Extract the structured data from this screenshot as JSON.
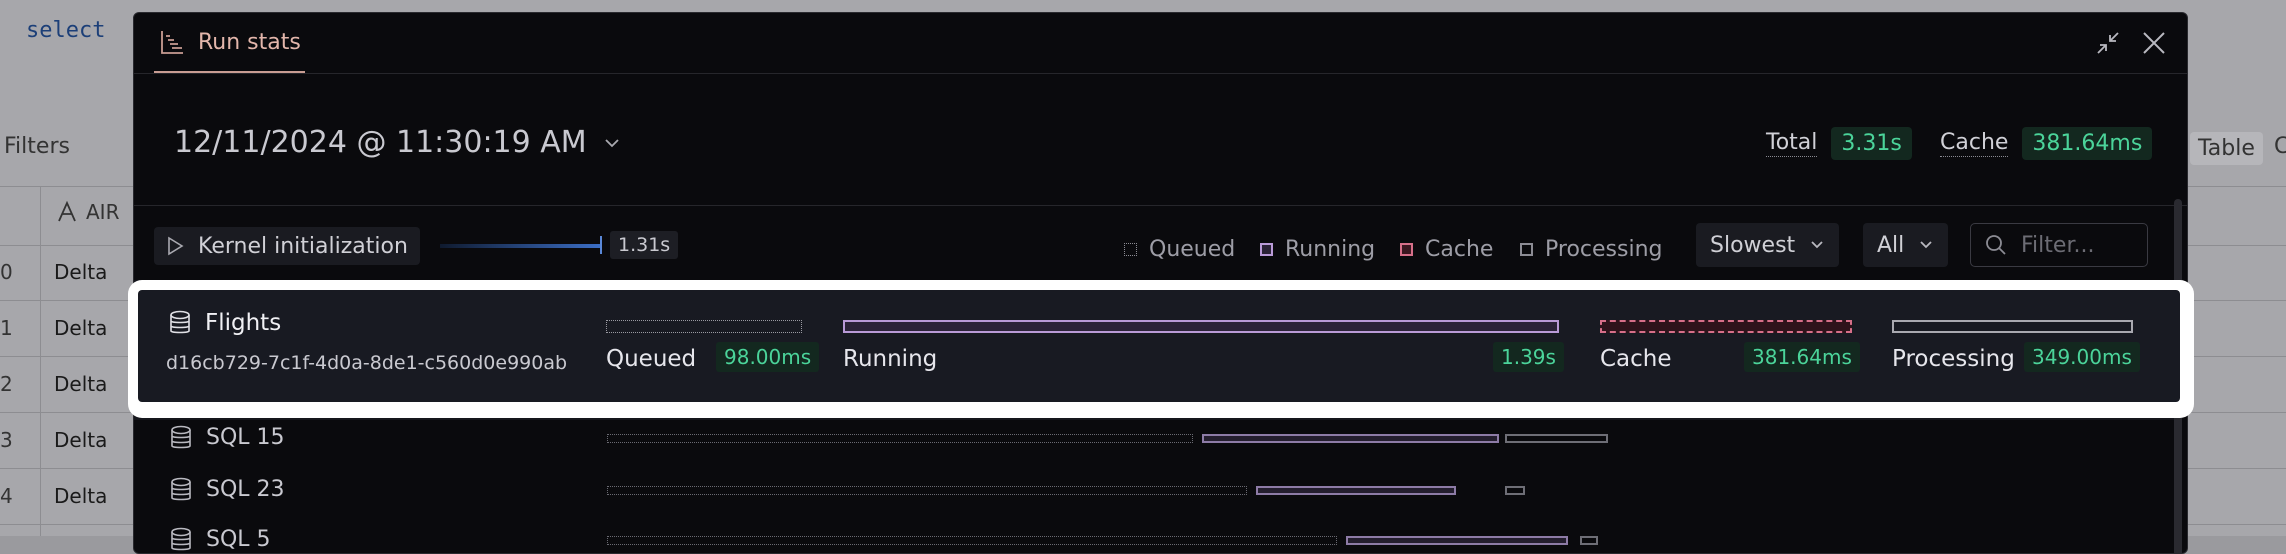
{
  "background": {
    "code_text": "select",
    "filters_label": "Filters",
    "table_button": "Table",
    "table_cut": "C",
    "column_header": "AIR",
    "rows": [
      {
        "index": "0",
        "value": "Delta"
      },
      {
        "index": "1",
        "value": "Delta"
      },
      {
        "index": "2",
        "value": "Delta"
      },
      {
        "index": "3",
        "value": "Delta"
      },
      {
        "index": "4",
        "value": "Delta"
      }
    ]
  },
  "modal": {
    "tab_label": "Run stats",
    "run_datetime": "12/11/2024 @ 11:30:19 AM",
    "total_label": "Total",
    "total_value": "3.31s",
    "cache_label": "Cache",
    "cache_value": "381.64ms",
    "kernel": {
      "label": "Kernel initialization",
      "time": "1.31s"
    },
    "legend": {
      "queued": "Queued",
      "running": "Running",
      "cache": "Cache",
      "processing": "Processing"
    },
    "sort_value": "Slowest",
    "filter_value": "All",
    "filter_placeholder": "Filter...",
    "colors": {
      "accent_tab": "#e3b6ab",
      "stat_green": "#4bd49a",
      "running": "#b99ad7",
      "cache": "#d66f89"
    }
  },
  "selected_cell": {
    "name": "Flights",
    "id": "d16cb729-7c1f-4d0a-8de1-c560d0e990ab",
    "queued_label": "Queued",
    "queued_value": "98.00ms",
    "running_label": "Running",
    "running_value": "1.39s",
    "cache_label": "Cache",
    "cache_value": "381.64ms",
    "processing_label": "Processing",
    "processing_value": "349.00ms"
  },
  "cells": [
    {
      "name": "SQL 15"
    },
    {
      "name": "SQL 23"
    },
    {
      "name": "SQL 5"
    }
  ]
}
